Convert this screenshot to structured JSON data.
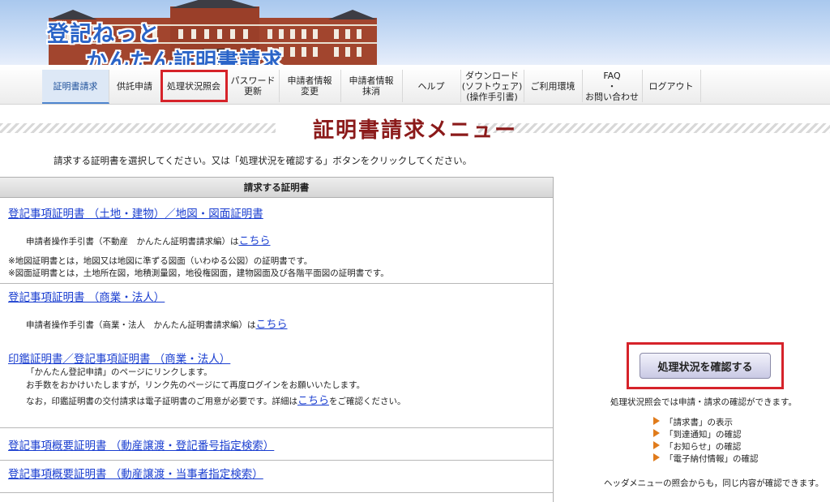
{
  "logo": {
    "line1": "登記ねっと",
    "line2": "かんたん証明書請求"
  },
  "nav": [
    {
      "label": "証明書請求"
    },
    {
      "label": "供託申請"
    },
    {
      "label": "処理状況照会"
    },
    {
      "label": "パスワード\n更新"
    },
    {
      "label": "申請者情報\n変更"
    },
    {
      "label": "申請者情報\n抹消"
    },
    {
      "label": "ヘルプ"
    },
    {
      "label": "ダウンロード\n(ソフトウェア)\n(操作手引書)"
    },
    {
      "label": "ご利用環境"
    },
    {
      "label": "FAQ\n・\nお問い合わせ"
    },
    {
      "label": "ログアウト"
    }
  ],
  "page": {
    "title": "証明書請求メニュー",
    "instruction": "請求する証明書を選択してください。又は「処理状況を確認する」ボタンをクリックしてください。"
  },
  "table": {
    "header": "請求する証明書",
    "sec1": {
      "link": "登記事項証明書 （土地・建物）／地図・図面証明書",
      "manual_text": "申請者操作手引書（不動産　かんたん証明書請求編）は",
      "manual_link": "こちら",
      "note1": "※地図証明書とは，地図又は地図に準ずる図面（いわゆる公図）の証明書です。",
      "note2": "※図面証明書とは，土地所在図，地積測量図，地役権図面，建物図面及び各階平面図の証明書です。"
    },
    "sec2": {
      "link": "登記事項証明書 （商業・法人）",
      "manual_text": "申請者操作手引書（商業・法人　かんたん証明書請求編）は",
      "manual_link": "こちら",
      "link2": "印鑑証明書／登記事項証明書 （商業・法人）",
      "line1": "「かんたん登記申請」のページにリンクします。",
      "line2": "お手数をおかけいたしますが，リンク先のページにて再度ログインをお願いいたします。",
      "line3_pre": "なお，印鑑証明書の交付請求は電子証明書のご用意が必要です。詳細は",
      "line3_link": "こちら",
      "line3_post": "をご確認ください。"
    },
    "sec3": {
      "link": "登記事項概要証明書 （動産譲渡・登記番号指定検索）"
    },
    "sec4": {
      "link": "登記事項概要証明書 （動産譲渡・当事者指定検索）"
    }
  },
  "side": {
    "button": "処理状況を確認する",
    "desc": "処理状況照会では申請・請求の確認ができます。",
    "items": [
      "「請求書」の表示",
      "「到達通知」の確認",
      "「お知らせ」の確認",
      "「電子納付情報」の確認"
    ],
    "footer": "ヘッダメニューの照会からも，同じ内容が確認できます。"
  },
  "colors": {
    "highlight": "#d6232a",
    "title": "#8b1a1a",
    "link": "#1a3ed0",
    "bullet": "#e07b1b"
  }
}
